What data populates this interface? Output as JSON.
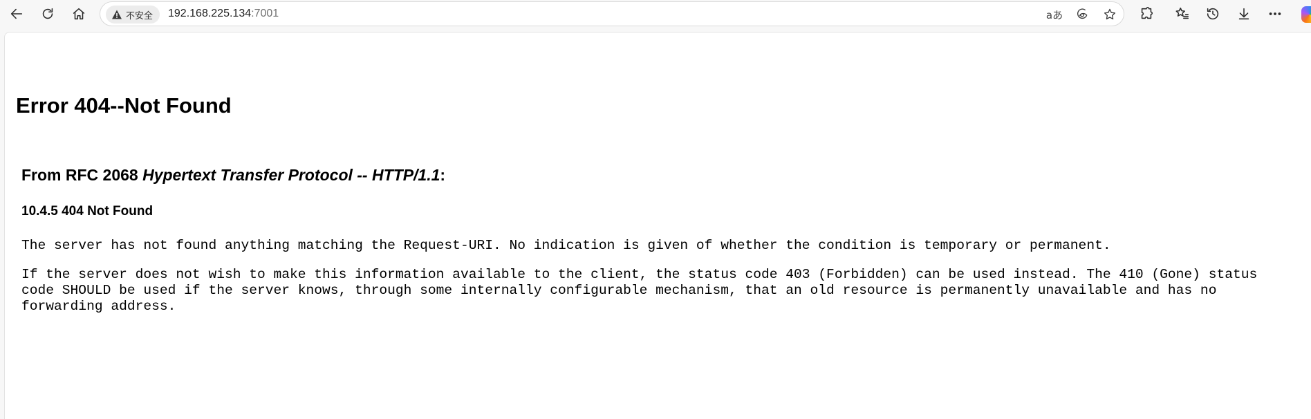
{
  "browser": {
    "nav": {
      "back_icon": "back-arrow-icon",
      "reload_icon": "reload-icon",
      "home_icon": "home-icon"
    },
    "address_bar": {
      "security_label": "不安全",
      "security_icon": "warning-triangle-icon",
      "url_host": "192.168.225.134",
      "url_port": ":7001"
    },
    "address_bar_icons": [
      "read-aloud-icon",
      "edge-icon",
      "favorite-star-icon"
    ],
    "read_aloud_glyph": "aあ",
    "toolbar_icons": [
      "extensions-icon",
      "favorites-icon",
      "history-icon",
      "downloads-icon",
      "more-icon",
      "copilot-icon"
    ]
  },
  "page": {
    "title": "Error 404--Not Found",
    "rfc_prefix": "From RFC 2068 ",
    "rfc_title": "Hypertext Transfer Protocol -- HTTP/1.1",
    "rfc_suffix": ":",
    "section": "10.4.5 404 Not Found",
    "paragraph1": "The server has not found anything matching the Request-URI. No indication is given of whether the condition is temporary or permanent.",
    "paragraph2": "If the server does not wish to make this information available to the client, the status code 403 (Forbidden) can be used instead. The 410 (Gone) status code SHOULD be used if the server knows, through some internally configurable mechanism, that an old resource is permanently unavailable and has no forwarding address."
  }
}
